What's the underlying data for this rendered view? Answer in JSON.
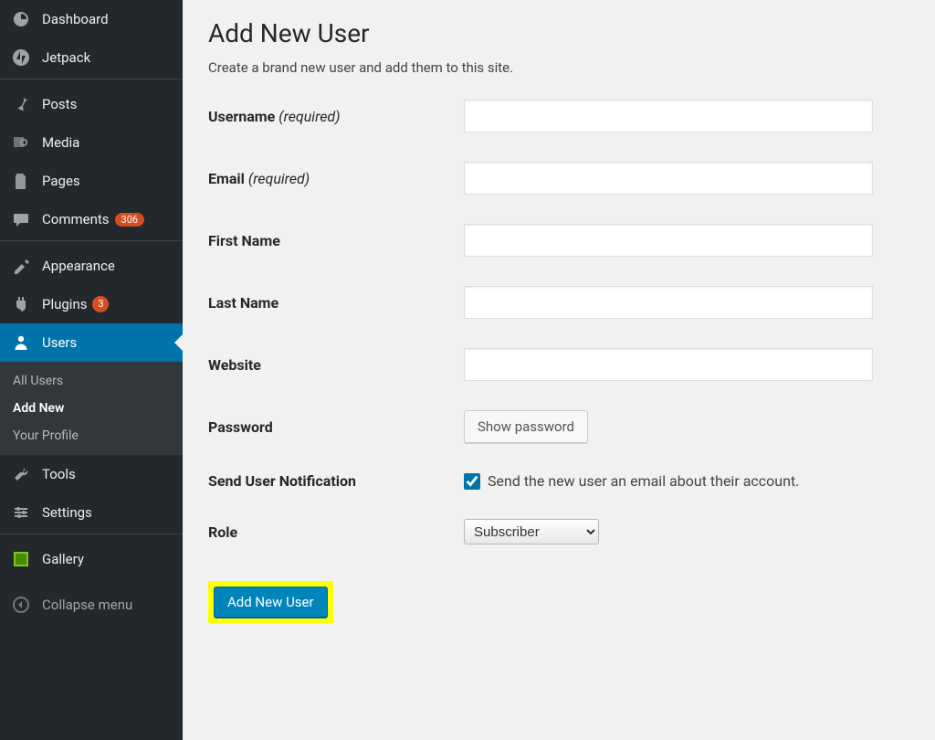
{
  "sidebar": {
    "items": [
      {
        "label": "Dashboard"
      },
      {
        "label": "Jetpack"
      },
      {
        "label": "Posts"
      },
      {
        "label": "Media"
      },
      {
        "label": "Pages"
      },
      {
        "label": "Comments",
        "badge": "306"
      },
      {
        "label": "Appearance"
      },
      {
        "label": "Plugins",
        "badge_circle": "3"
      },
      {
        "label": "Users"
      },
      {
        "label": "Tools"
      },
      {
        "label": "Settings"
      },
      {
        "label": "Gallery"
      }
    ],
    "submenu": [
      "All Users",
      "Add New",
      "Your Profile"
    ],
    "collapse": "Collapse menu"
  },
  "page": {
    "title": "Add New User",
    "subtitle": "Create a brand new user and add them to this site."
  },
  "form": {
    "username_label": "Username ",
    "username_req": "(required)",
    "email_label": "Email ",
    "email_req": "(required)",
    "firstname_label": "First Name",
    "lastname_label": "Last Name",
    "website_label": "Website",
    "password_label": "Password",
    "show_password_btn": "Show password",
    "notify_label": "Send User Notification",
    "notify_desc": "Send the new user an email about their account.",
    "role_label": "Role",
    "role_value": "Subscriber",
    "submit": "Add New User"
  }
}
